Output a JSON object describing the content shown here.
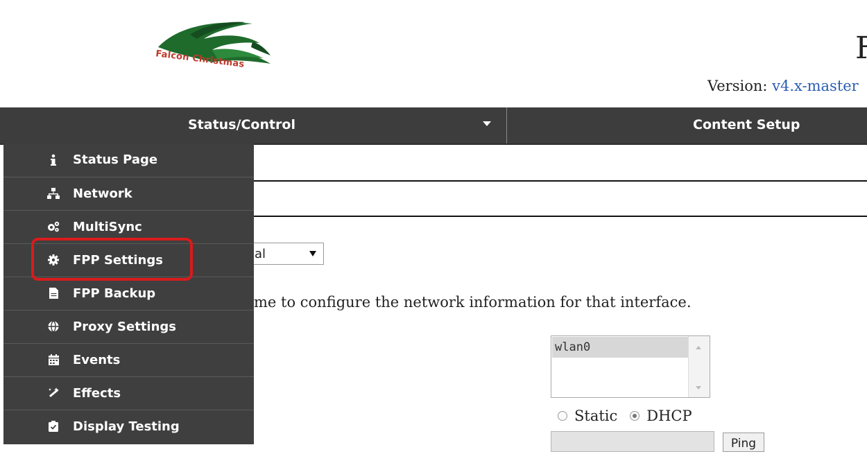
{
  "header": {
    "logo_text": "Falcon Christmas",
    "title": "F",
    "version_label": "Version:",
    "version_value": "v4.x-master"
  },
  "nav": {
    "status_control": "Status/Control",
    "content_setup": "Content Setup"
  },
  "dropdown": {
    "items": [
      {
        "label": "Status Page",
        "icon": "info-icon"
      },
      {
        "label": "Network",
        "icon": "network-icon"
      },
      {
        "label": "MultiSync",
        "icon": "cogs-icon"
      },
      {
        "label": "FPP Settings",
        "icon": "gear-icon"
      },
      {
        "label": "FPP Backup",
        "icon": "file-icon"
      },
      {
        "label": "Proxy Settings",
        "icon": "globe-icon"
      },
      {
        "label": "Events",
        "icon": "calendar-icon"
      },
      {
        "label": "Effects",
        "icon": "magic-wand-icon"
      },
      {
        "label": "Display Testing",
        "icon": "clipboard-check-icon"
      }
    ],
    "highlight_color": "#d81b1b"
  },
  "content": {
    "select_value": "al",
    "instruction": "me to configure the network information for that interface.",
    "interface_option": "wlan0",
    "radio_static": "Static",
    "radio_dhcp": "DHCP",
    "ping_label": "Ping"
  }
}
